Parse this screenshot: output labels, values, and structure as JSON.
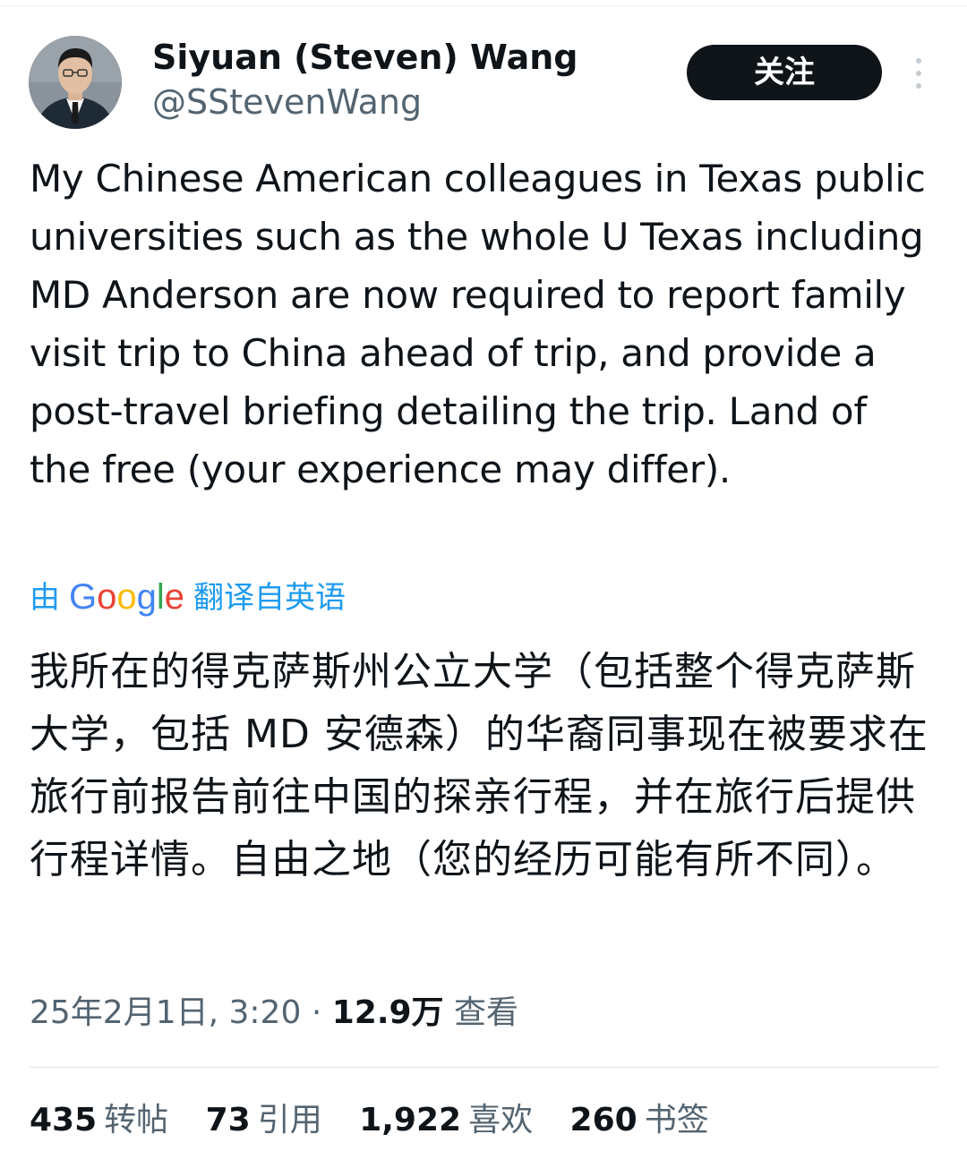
{
  "author": {
    "display_name": "Siyuan (Steven) Wang",
    "handle": "@SStevenWang",
    "avatar_icon": "profile-photo"
  },
  "follow_button": {
    "label": "关注"
  },
  "more_icon": "more-vertical-icon",
  "tweet": {
    "text": "My Chinese American colleagues in Texas public universities such as the whole U Texas including MD Anderson are now required to report family visit trip to China ahead of trip, and provide a post-travel briefing detailing the trip. Land of the free (your experience may differ)."
  },
  "translation": {
    "prefix": "由",
    "provider": "Google",
    "suffix": "翻译自英语",
    "text": "我所在的得克萨斯州公立大学（包括整个得克萨斯大学，包括 MD 安德森）的华裔同事现在被要求在旅行前报告前往中国的探亲行程，并在旅行后提供行程详情。自由之地（您的经历可能有所不同）。"
  },
  "meta": {
    "timestamp": "25年2月1日, 3:20",
    "separator": "·",
    "views_count": "12.9万",
    "views_label": "查看"
  },
  "stats": [
    {
      "count": "435",
      "label": "转帖"
    },
    {
      "count": "73",
      "label": "引用"
    },
    {
      "count": "1,922",
      "label": "喜欢"
    },
    {
      "count": "260",
      "label": "书签"
    }
  ],
  "colors": {
    "text_primary": "#0f1419",
    "text_secondary": "#536471",
    "link_blue": "#1d9bf0",
    "google_blue": "#4285f4",
    "google_red": "#ea4335",
    "google_yellow": "#fbbc05",
    "google_green": "#34a853"
  }
}
